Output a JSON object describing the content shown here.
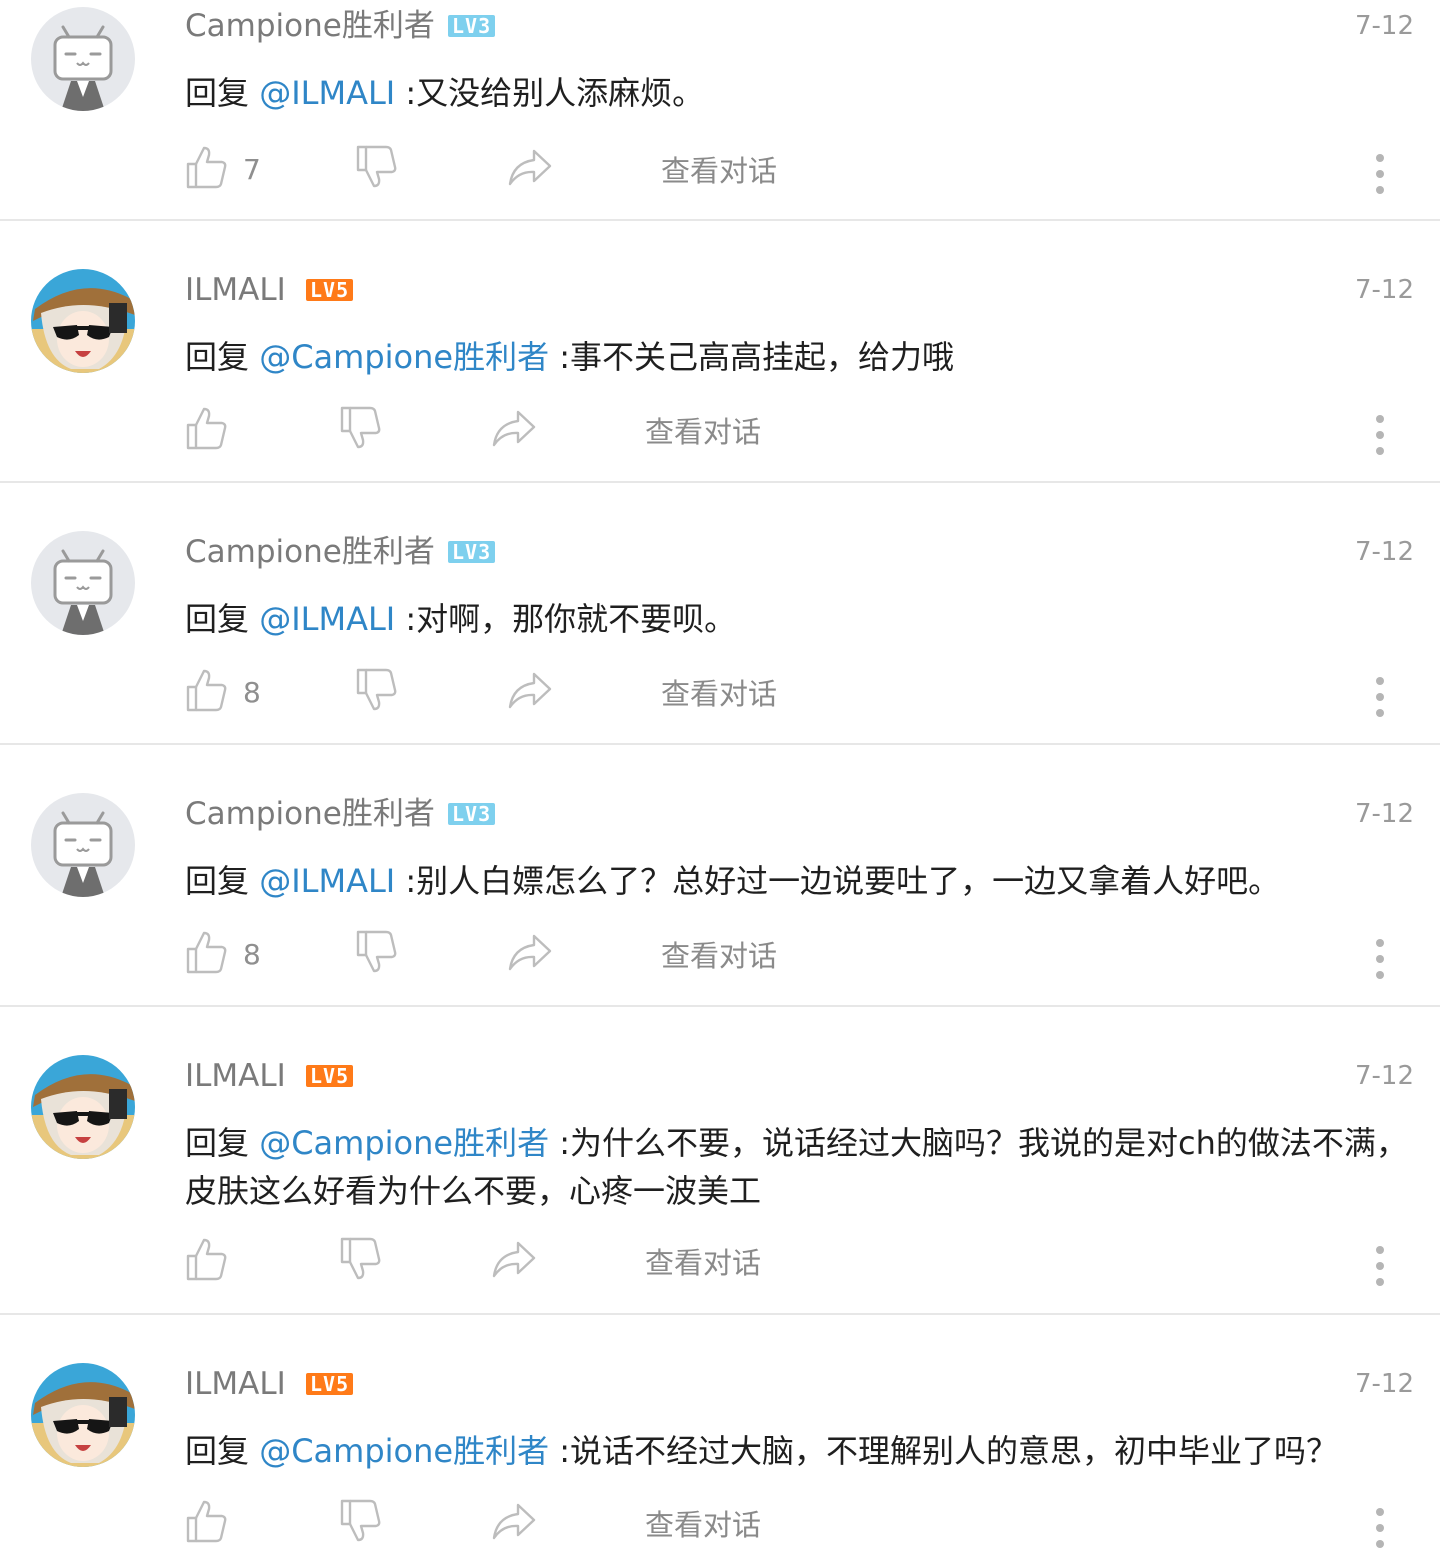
{
  "colors": {
    "mention": "#2f86c7",
    "level3": "#7ed0ee",
    "level5": "#ff7a18",
    "divider": "#e7e7e7"
  },
  "icons": {
    "like": "thumbs-up-icon",
    "dislike": "thumbs-down-icon",
    "share": "share-icon",
    "more": "more-vertical-icon"
  },
  "comments": [
    {
      "user": "Campione胜利者",
      "level": "LV3",
      "date": "7-12",
      "reply_prefix": "回复",
      "mention": "@ILMALI",
      "text": ":又没给别人添麻烦。",
      "likes": "7",
      "view_conversation": "查看对话"
    },
    {
      "user": "ILMALI",
      "level": "LV5",
      "date": "7-12",
      "reply_prefix": "回复",
      "mention": "@Campione胜利者",
      "text": ":事不关己高高挂起，给力哦",
      "likes": "",
      "view_conversation": "查看对话"
    },
    {
      "user": "Campione胜利者",
      "level": "LV3",
      "date": "7-12",
      "reply_prefix": "回复",
      "mention": "@ILMALI",
      "text": ":对啊，那你就不要呗。",
      "likes": "8",
      "view_conversation": "查看对话"
    },
    {
      "user": "Campione胜利者",
      "level": "LV3",
      "date": "7-12",
      "reply_prefix": "回复",
      "mention": "@ILMALI",
      "text": ":别人白嫖怎么了？总好过一边说要吐了，一边又拿着人好吧。",
      "likes": "8",
      "view_conversation": "查看对话"
    },
    {
      "user": "ILMALI",
      "level": "LV5",
      "date": "7-12",
      "reply_prefix": "回复",
      "mention": "@Campione胜利者",
      "text": ":为什么不要，说话经过大脑吗？我说的是对ch的做法不满，皮肤这么好看为什么不要，心疼一波美工",
      "likes": "",
      "view_conversation": "查看对话"
    },
    {
      "user": "ILMALI",
      "level": "LV5",
      "date": "7-12",
      "reply_prefix": "回复",
      "mention": "@Campione胜利者",
      "text": ":说话不经过大脑，不理解别人的意思，初中毕业了吗？",
      "likes": "",
      "view_conversation": "查看对话"
    }
  ]
}
